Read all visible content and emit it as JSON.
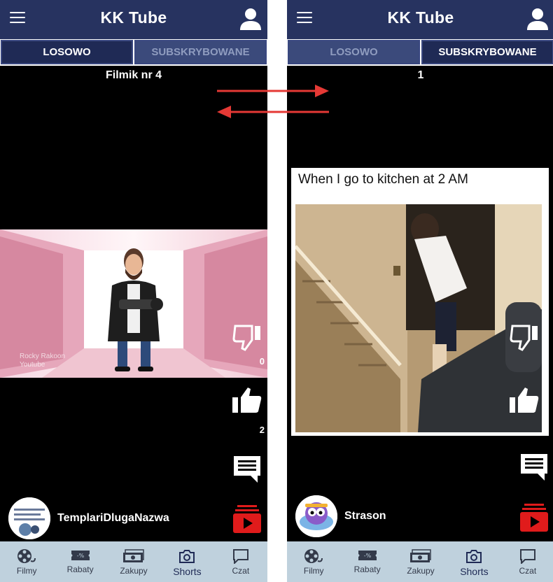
{
  "app_title": "KK Tube",
  "tabs": {
    "random": "LOSOWO",
    "subscribed": "SUBSKRYBOWANE"
  },
  "left": {
    "video_title": "Filmik nr 4",
    "dislikes": "0",
    "likes": "2",
    "channel_name": "TemplariDlugaNazwa",
    "watermark": "Rocky Rakoon\nYoutube"
  },
  "right": {
    "video_title": "1",
    "caption": "When I go to kitchen at 2 AM",
    "channel_name": "Strason"
  },
  "nav": [
    {
      "label": "Filmy",
      "icon": "film-reel-icon"
    },
    {
      "label": "Rabaty",
      "icon": "discount-ticket-icon"
    },
    {
      "label": "Zakupy",
      "icon": "money-icon"
    },
    {
      "label": "Shorts",
      "icon": "camera-icon"
    },
    {
      "label": "Czat",
      "icon": "chat-icon"
    }
  ],
  "colors": {
    "appbar": "#273360",
    "navbar": "#bfd1dd",
    "subscribe_red": "#e01b1b",
    "arrow_red": "#e53935"
  }
}
